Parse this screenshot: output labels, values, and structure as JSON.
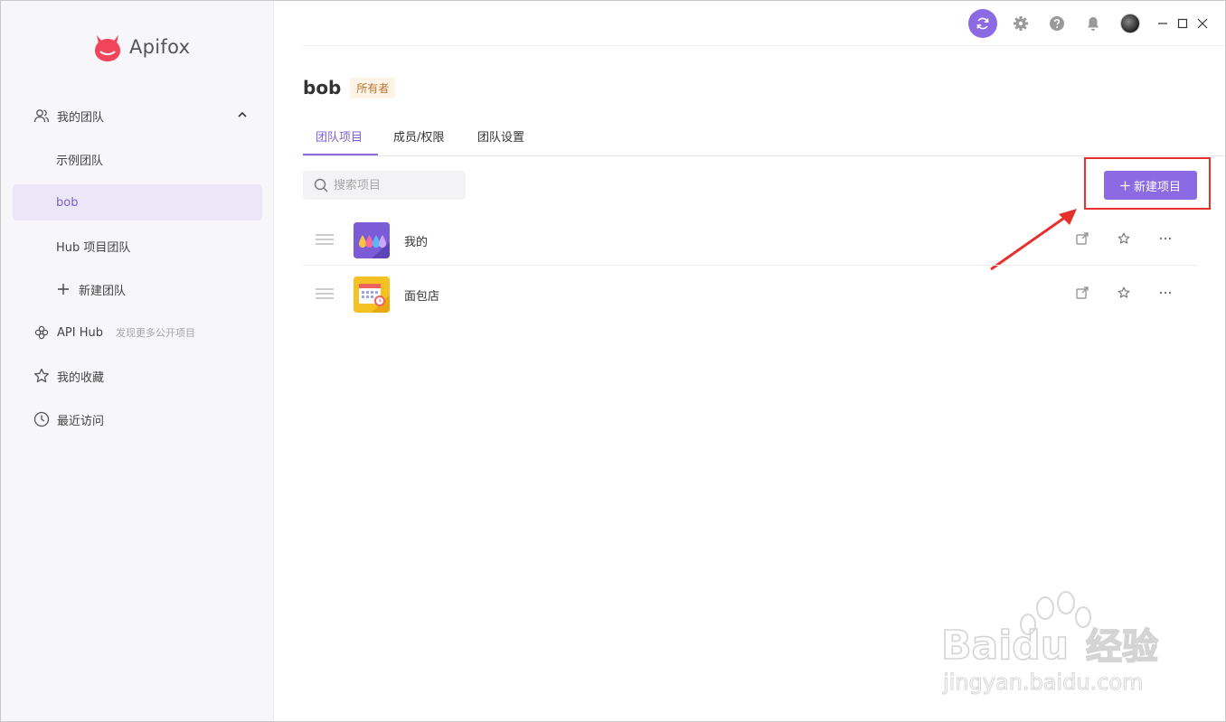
{
  "app": {
    "brand_name": "Apifox"
  },
  "sidebar": {
    "my_team_label": "我的团队",
    "teams": [
      {
        "label": "示例团队"
      },
      {
        "label": "bob"
      },
      {
        "label": "Hub 项目团队"
      }
    ],
    "new_team_label": "新建团队",
    "api_hub_label": "API Hub",
    "api_hub_hint": "发现更多公开项目",
    "favorites_label": "我的收藏",
    "recent_label": "最近访问"
  },
  "header": {
    "team_name": "bob",
    "role_badge": "所有者"
  },
  "tabs": [
    {
      "label": "团队项目"
    },
    {
      "label": "成员/权限"
    },
    {
      "label": "团队设置"
    }
  ],
  "toolbar": {
    "search_placeholder": "搜索项目",
    "new_project_label": "新建项目"
  },
  "projects": [
    {
      "name": "我的"
    },
    {
      "name": "面包店"
    }
  ],
  "colors": {
    "accent": "#8c6ae3",
    "highlight": "#e5302c",
    "owner_badge_text": "#b9742b"
  },
  "watermark": {
    "brand": "Baidu",
    "product": "经验",
    "url": "jingyan.baidu.com"
  }
}
